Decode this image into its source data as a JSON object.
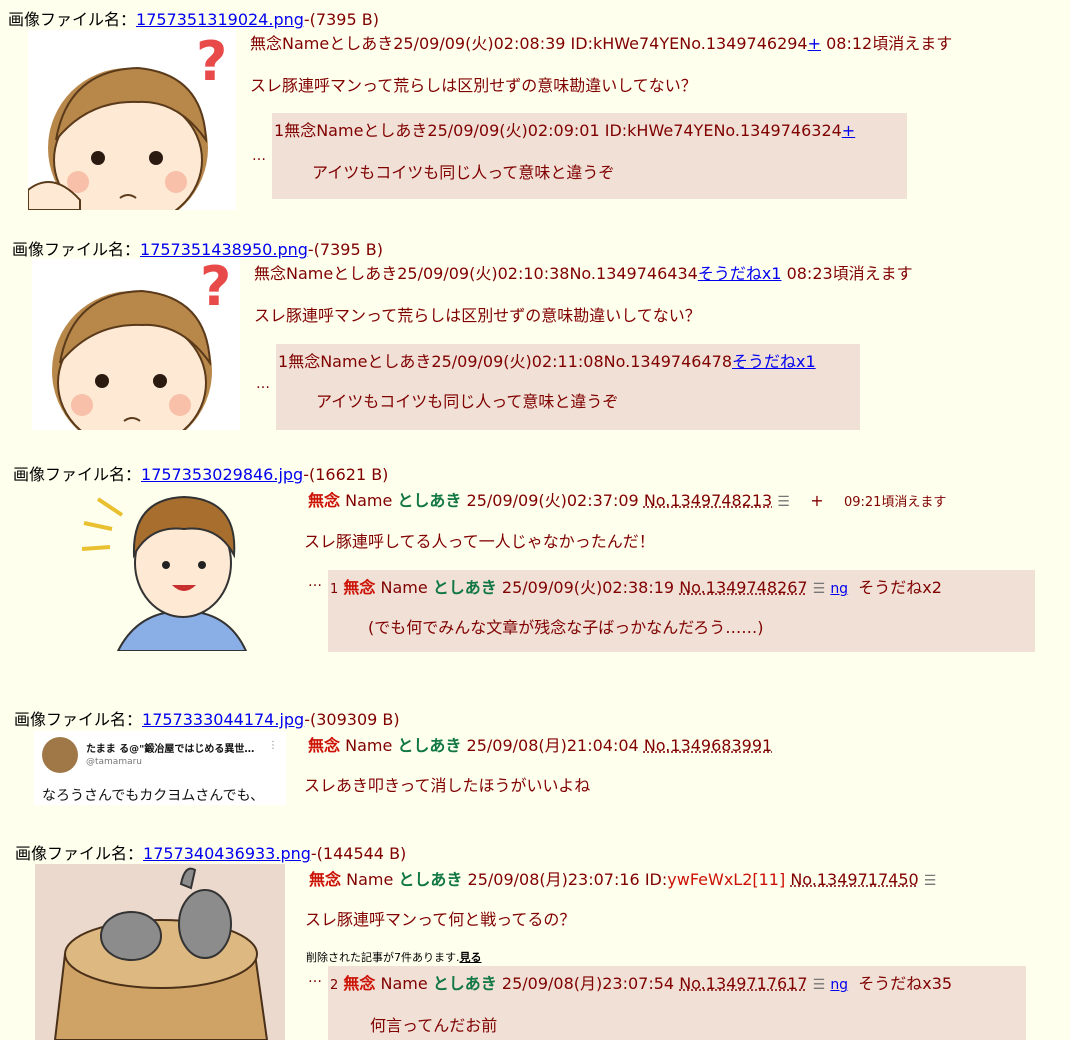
{
  "posts": [
    {
      "file_label": "画像ファイル名：",
      "file_name": "1757351319024.png",
      "file_size": "-(7395 B)",
      "header": {
        "subject": "無念",
        "name": "Name",
        "user": "としあき",
        "date": "25/09/09(火)02:08:39",
        "id": "ID:kHWe74YE",
        "no": "No.1349746294",
        "plus": "+",
        "expire": "08:12頃消えます"
      },
      "text": "スレ豚連呼マンって荒らしは区別せずの意味勘違いしてない？",
      "reply": {
        "index": "1",
        "subject": "無念",
        "name": "Name",
        "user": "としあき",
        "date": "25/09/09(火)02:09:01",
        "id": "ID:kHWe74YE",
        "no": "No.1349746324",
        "plus": "+",
        "text": "アイツもコイツも同じ人って意味と違うぞ"
      }
    },
    {
      "file_label": "画像ファイル名：",
      "file_name": "1757351438950.png",
      "file_size": "-(7395 B)",
      "header": {
        "subject": "無念",
        "name": "Name",
        "user": "としあき",
        "date": "25/09/09(火)02:10:38",
        "no": "No.1349746434",
        "sodane": "そうだねx1",
        "expire": "08:23頃消えます"
      },
      "text": "スレ豚連呼マンって荒らしは区別せずの意味勘違いしてない？",
      "reply": {
        "index": "1",
        "subject": "無念",
        "name": "Name",
        "user": "としあき",
        "date": "25/09/09(火)02:11:08",
        "no": "No.1349746478",
        "sodane": "そうだねx1",
        "text": "アイツもコイツも同じ人って意味と違うぞ"
      }
    },
    {
      "file_label": "画像ファイル名：",
      "file_name": "1757353029846.jpg",
      "file_size": "-(16621 B)",
      "header": {
        "subject": "無念",
        "name": "Name",
        "user": "としあき",
        "date": "25/09/09(火)02:37:09",
        "no": "No.1349748213",
        "menu": "☰",
        "plus": "+",
        "expire": "09:21頃消えます"
      },
      "text": "スレ豚連呼してる人って一人じゃなかったんだ！",
      "reply": {
        "index": "1",
        "subject": "無念",
        "name": "Name",
        "user": "としあき",
        "date": "25/09/09(火)02:38:19",
        "no": "No.1349748267",
        "menu": "☰",
        "ng": "ng",
        "sodane": "そうだねx2",
        "text": "(でも何でみんな文章が残念な子ばっかなんだろう……)"
      }
    },
    {
      "file_label": "画像ファイル名：",
      "file_name": "1757333044174.jpg",
      "file_size": "-(309309 B)",
      "thumb": {
        "account": "たまま る@\"鍛冶屋ではじめる異世…",
        "handle": "@tamamaru",
        "line": "なろうさんでもカクヨムさんでも、",
        "more": "⋮"
      },
      "header": {
        "subject": "無念",
        "name": "Name",
        "user": "としあき",
        "date": "25/09/08(月)21:04:04",
        "no": "No.1349683991"
      },
      "text": "スレあき叩きって消したほうがいいよね"
    },
    {
      "file_label": "画像ファイル名：",
      "file_name": "1757340436933.png",
      "file_size": "-(144544 B)",
      "header": {
        "subject": "無念",
        "name": "Name",
        "user": "としあき",
        "date": "25/09/08(月)23:07:16",
        "id_label": "ID:",
        "id": "ywFeWxL2[11]",
        "no": "No.1349717450",
        "menu": "☰"
      },
      "text": "スレ豚連呼マンって何と戦ってるの？",
      "deleted": "削除された記事が7件あります.",
      "deleted_link": "見る",
      "reply": {
        "index": "2",
        "subject": "無念",
        "name": "Name",
        "user": "としあき",
        "date": "25/09/08(月)23:07:54",
        "no": "No.1349717617",
        "menu": "☰",
        "ng": "ng",
        "sodane": "そうだねx35",
        "text": "何言ってんだお前"
      }
    }
  ],
  "ellipsis": "…"
}
